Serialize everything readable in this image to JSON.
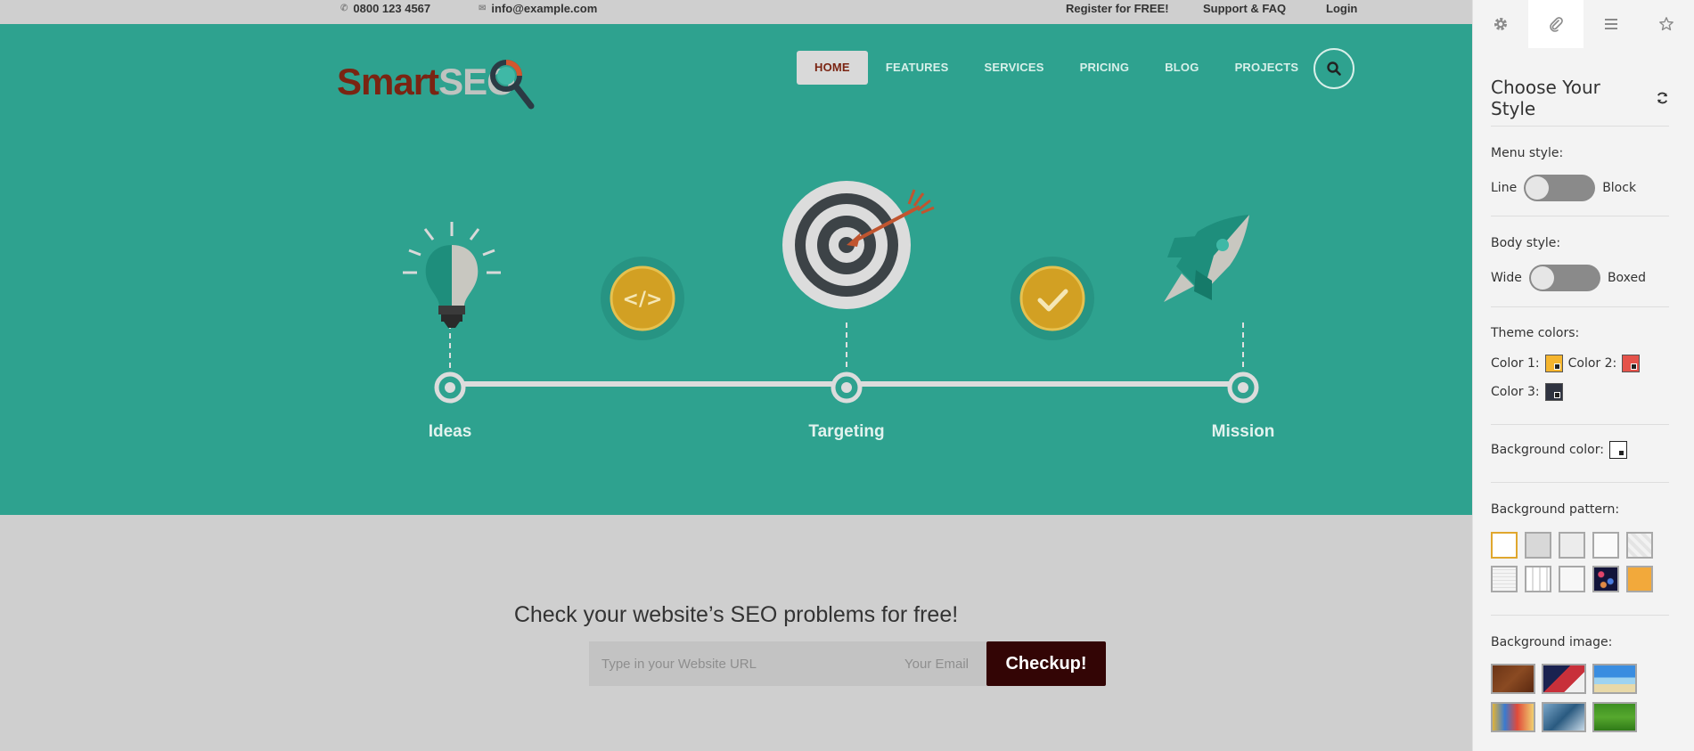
{
  "topbar": {
    "phone": "0800 123 4567",
    "email": "info@example.com",
    "links": [
      "Register for FREE!",
      "Support & FAQ",
      "Login"
    ]
  },
  "logo": {
    "part1": "Smart",
    "part2": "SEO"
  },
  "nav": {
    "items": [
      "HOME",
      "FEATURES",
      "SERVICES",
      "PRICING",
      "BLOG",
      "PROJECTS"
    ],
    "active": "HOME"
  },
  "timeline": {
    "steps": [
      "Ideas",
      "Targeting",
      "Mission"
    ]
  },
  "seo_check": {
    "title": "Check your website’s SEO problems for free!",
    "url_placeholder": "Type in your Website URL",
    "email_placeholder": "Your Email",
    "button": "Checkup!"
  },
  "panel": {
    "tabs": [
      "gear-icon",
      "paperclip-icon",
      "menu-icon",
      "star-icon"
    ],
    "title": "Choose Your Style",
    "menu_style": {
      "label": "Menu style:",
      "left": "Line",
      "right": "Block"
    },
    "body_style": {
      "label": "Body style:",
      "left": "Wide",
      "right": "Boxed"
    },
    "theme_colors": {
      "label": "Theme colors:",
      "color1": {
        "label": "Color 1:",
        "value": "#f5b52e"
      },
      "color2": {
        "label": "Color 2:",
        "value": "#e5534b"
      },
      "color3": {
        "label": "Color 3:",
        "value": "#2f3340"
      }
    },
    "background_color": {
      "label": "Background color:",
      "value": "#ffffff"
    },
    "background_pattern": {
      "label": "Background pattern:"
    },
    "background_image": {
      "label": "Background image:"
    }
  },
  "colors": {
    "hero": "#2ea28f",
    "accent": "#7a2412",
    "gold": "#d2a023",
    "dark": "#330505"
  }
}
